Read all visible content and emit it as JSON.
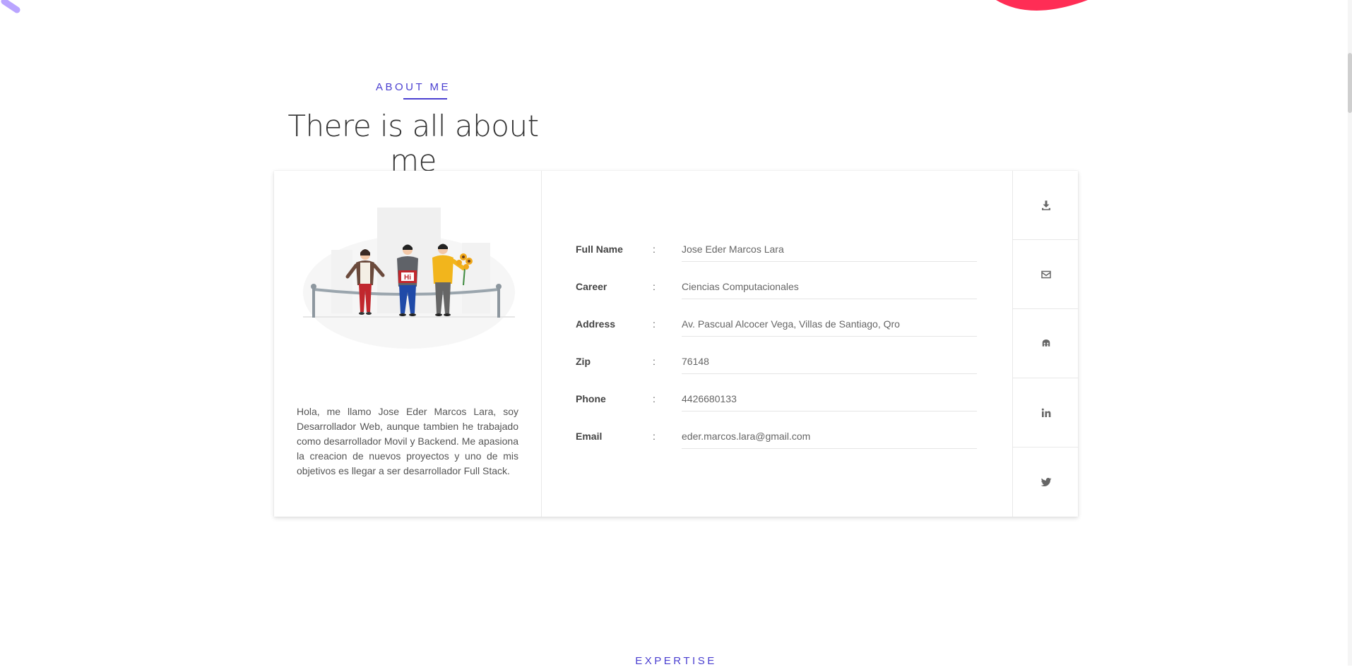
{
  "about": {
    "eyebrow": "ABOUT ME",
    "title": "There is all about me",
    "bio": "Hola, me llamo Jose Eder Marcos Lara, soy Desarrollador Web, aunque tambien he trabajado como desarrollador Movil y Backend. Me apasiona la creacion de nuevos proyectos y uno de mis objetivos es llegar a ser desarrollador Full Stack.",
    "illustration_text": "Hi"
  },
  "info": [
    {
      "label": "Full Name",
      "colon": ":",
      "value": "Jose Eder Marcos Lara"
    },
    {
      "label": "Career",
      "colon": ":",
      "value": "Ciencias Computacionales"
    },
    {
      "label": "Address",
      "colon": ":",
      "value": "Av. Pascual Alcocer Vega, Villas de Santiago, Qro"
    },
    {
      "label": "Zip",
      "colon": ":",
      "value": "76148"
    },
    {
      "label": "Phone",
      "colon": ":",
      "value": "4426680133"
    },
    {
      "label": "Email",
      "colon": ":",
      "value": "eder.marcos.lara@gmail.com"
    }
  ],
  "social": [
    {
      "icon": "download-icon"
    },
    {
      "icon": "mail-icon"
    },
    {
      "icon": "github-icon"
    },
    {
      "icon": "linkedin-icon"
    },
    {
      "icon": "twitter-icon"
    }
  ],
  "next_section": {
    "eyebrow": "EXPERTISE"
  },
  "colors": {
    "accent": "#4a3fd0",
    "decor_red": "#ff2d55",
    "decor_purple": "#b9a4ff"
  }
}
